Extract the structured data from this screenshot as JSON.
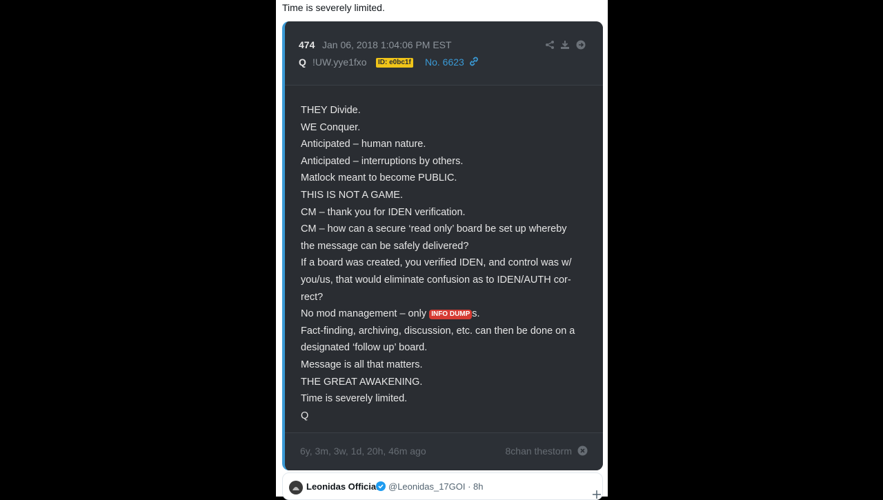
{
  "top_text": "Time is severely limited.",
  "post": {
    "number": "474",
    "date": "Jan 06, 2018 1:04:06 PM EST",
    "author": "Q",
    "tripcode": "!UW.yye1fxo",
    "id_badge": "ID: e0bc1f",
    "post_no": "No. 6623",
    "lines": [
      "THEY Divide.",
      "WE Conquer.",
      "Anticipated – human nature.",
      "Anticipated – interruptions by others.",
      "Matlock meant to become PUBLIC.",
      "THIS IS NOT A GAME.",
      "CM – thank you for IDEN verification.",
      "CM – how can a secure ‘read only’ board be set up whereby",
      "the message can be safely delivered?",
      "If a board was created, you verified IDEN, and control was w/",
      "you/us, that would eliminate confusion as to IDEN/AUTH cor-",
      "rect?"
    ],
    "dump_line": {
      "before": "No mod management – only ",
      "badge": "INFO DUMP",
      "after": "s."
    },
    "lines2": [
      "Fact-finding, archiving, discussion, etc. can then be done on a",
      "designated ‘follow up’ board.",
      "Message is all that matters.",
      "THE GREAT AWAKENING.",
      "Time is severely limited.",
      "Q"
    ],
    "ago": "6y, 3m, 3w, 1d, 20h, 46m ago",
    "source": "8chan thestorm"
  },
  "tweet": {
    "name": "Leonidas Official",
    "handle": "@Leonidas_17GOI · 8h"
  },
  "icons": [
    "share-icon",
    "download-icon",
    "arrow-right-icon",
    "link-icon",
    "close-icon",
    "verified-icon",
    "plus-icon"
  ],
  "colors": {
    "accent": "#3a9ad6",
    "badge_yellow": "#f0c419",
    "badge_red": "#d63b33",
    "card_bg": "#2a2d32"
  }
}
